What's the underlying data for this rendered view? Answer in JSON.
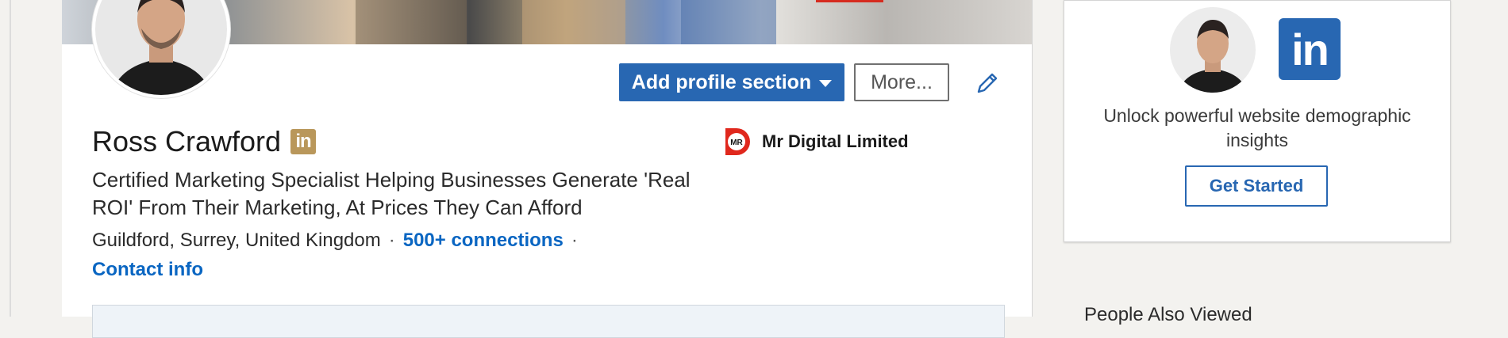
{
  "profile": {
    "name": "Ross Crawford",
    "badge_text": "in",
    "headline": "Certified Marketing Specialist Helping Businesses Generate 'Real ROI' From Their Marketing, At Prices They Can Afford",
    "location": "Guildford, Surrey, United Kingdom",
    "connections": "500+ connections",
    "contact_info": "Contact info",
    "separator": "·"
  },
  "actions": {
    "add_section_label": "Add profile section",
    "more_label": "More..."
  },
  "company": {
    "logo_text": "MR",
    "name": "Mr Digital Limited"
  },
  "insights_card": {
    "logo_text": "in",
    "text": "Unlock powerful website demographic insights",
    "button_label": "Get Started"
  },
  "people_also_viewed": "People Also Viewed",
  "colors": {
    "primary": "#2867b2",
    "link": "#0a66c2",
    "badge_gold": "#b9975b",
    "company_red": "#e0281d"
  },
  "icons": {
    "caret": "caret-down-icon",
    "edit": "pencil-icon",
    "badge": "linkedin-premium-icon"
  }
}
